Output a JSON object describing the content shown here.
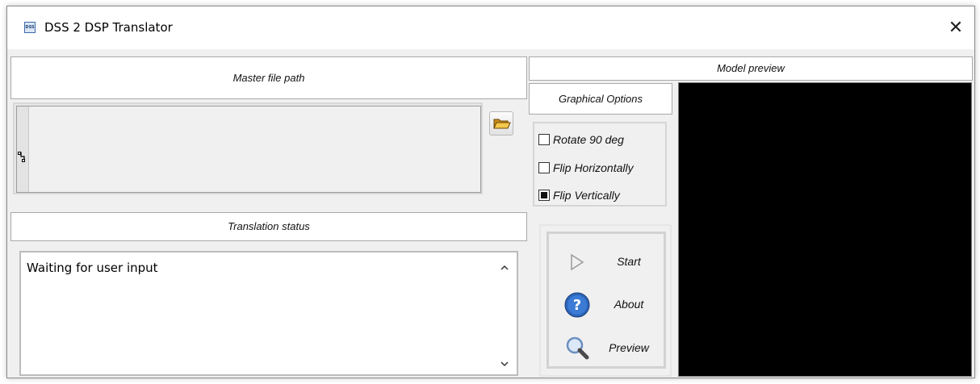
{
  "window": {
    "title": "DSS 2 DSP Translator",
    "app_icon_text": "DSS",
    "close_glyph": "✕"
  },
  "master_path": {
    "header": "Master file path",
    "value": ""
  },
  "translation": {
    "header": "Translation status",
    "status_text": "Waiting for user input"
  },
  "graphical_options": {
    "header": "Graphical Options",
    "options": [
      {
        "label": "Rotate 90 deg",
        "checked": false
      },
      {
        "label": "Flip Horizontally",
        "checked": false
      },
      {
        "label": "Flip Vertically",
        "checked": true
      }
    ]
  },
  "actions": {
    "start_label": "Start",
    "about_label": "About",
    "preview_label": "Preview"
  },
  "preview": {
    "header": "Model preview",
    "background": "#000000"
  },
  "icons": {
    "folder": "folder-open-icon",
    "start": "play-icon",
    "about": "help-icon",
    "preview": "magnifier-icon"
  }
}
